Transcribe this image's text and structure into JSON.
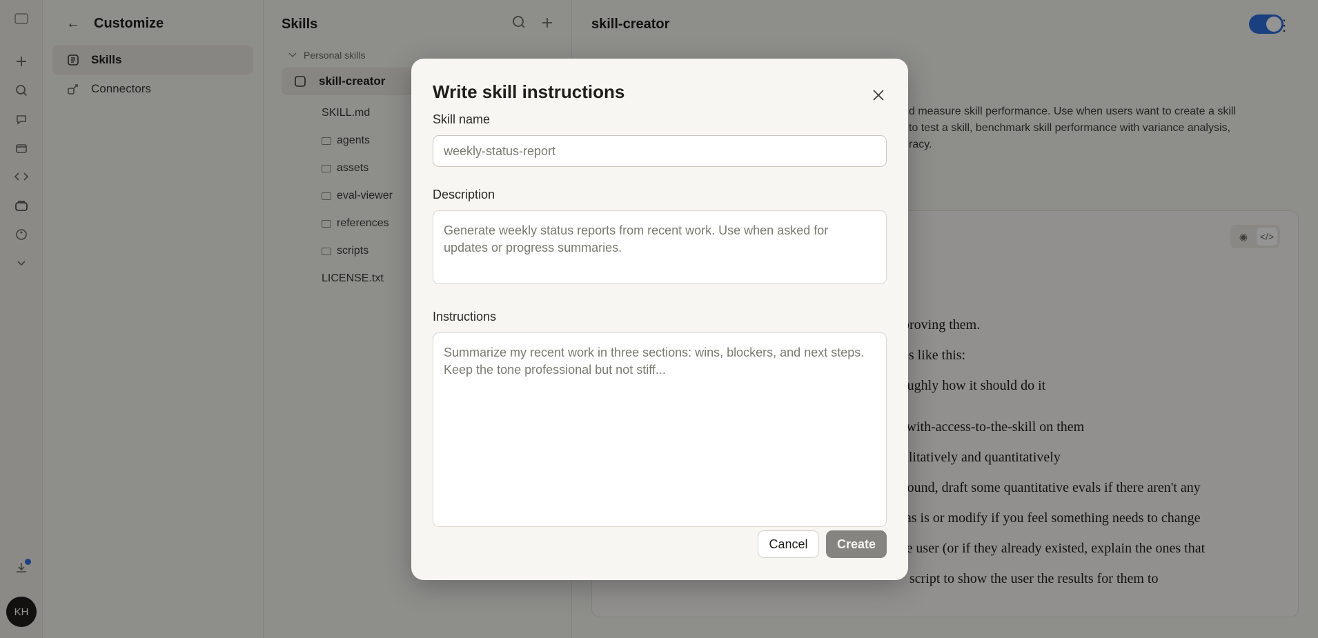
{
  "sidebar": {
    "back_label": "←",
    "title": "Customize",
    "items": [
      {
        "label": "Skills",
        "icon": "skills-icon",
        "active": true
      },
      {
        "label": "Connectors",
        "icon": "connectors-icon",
        "active": false
      }
    ],
    "avatar_initials": "KH"
  },
  "skills_panel": {
    "title": "Skills",
    "group_label": "Personal skills",
    "selected_skill": "skill-creator",
    "files": [
      {
        "name": "SKILL.md",
        "type": "file"
      },
      {
        "name": "agents",
        "type": "folder"
      },
      {
        "name": "assets",
        "type": "folder"
      },
      {
        "name": "eval-viewer",
        "type": "folder"
      },
      {
        "name": "references",
        "type": "folder"
      },
      {
        "name": "scripts",
        "type": "folder"
      },
      {
        "name": "LICENSE.txt",
        "type": "file"
      }
    ]
  },
  "main": {
    "title": "skill-creator",
    "enabled": true,
    "description_lines": [
      "d measure skill performance. Use when users want to create a skill",
      "to test a skill, benchmark skill performance with variance analysis,",
      "racy."
    ],
    "content_lines": [
      "nproving them.",
      "pes like this:",
      "roughly how it should do it",
      "e-with-access-to-the-skill on them",
      "ualitatively and quantitatively",
      "ground, draft some quantitative evals if there aren't any",
      "e as is or modify if you feel something needs to change",
      "the user (or if they already existed, explain the ones that"
    ],
    "content_tail": "script to show the user the results for them to"
  },
  "modal": {
    "title": "Write skill instructions",
    "name_label": "Skill name",
    "name_placeholder": "weekly-status-report",
    "name_value": "",
    "description_label": "Description",
    "description_placeholder": "Generate weekly status reports from recent work. Use when asked for updates or progress summaries.",
    "instructions_label": "Instructions",
    "instructions_placeholder": "Summarize my recent work in three sections: wins, blockers, and next steps. Keep the tone professional but not stiff...",
    "cancel_label": "Cancel",
    "create_label": "Create"
  },
  "colors": {
    "accent": "#2f6fdd",
    "overlay": "rgba(0,0,0,0.42)",
    "create_disabled": "#858480"
  }
}
